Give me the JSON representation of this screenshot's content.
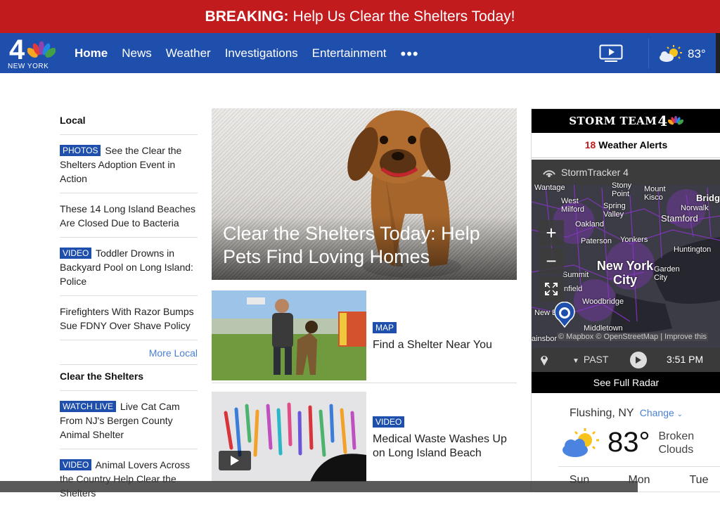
{
  "breaking": {
    "label": "BREAKING:",
    "text": "Help Us Clear the Shelters Today!"
  },
  "nav": {
    "logo_text": "NEW YORK",
    "logo_number": "4",
    "items": [
      "Home",
      "News",
      "Weather",
      "Investigations",
      "Entertainment"
    ],
    "more": "•••",
    "temp": "83°"
  },
  "local": {
    "title": "Local",
    "items": [
      {
        "tag": "PHOTOS",
        "text": "See the Clear the Shelters Adoption Event in Action"
      },
      {
        "tag": "",
        "text": "These 14 Long Island Beaches Are Closed Due to Bacteria"
      },
      {
        "tag": "VIDEO",
        "text": "Toddler Drowns in Backyard Pool on Long Island: Police"
      },
      {
        "tag": "",
        "text": "Firefighters With Razor Bumps Sue FDNY Over Shave Policy"
      }
    ],
    "more": "More Local"
  },
  "shelters": {
    "title": "Clear the Shelters",
    "items": [
      {
        "tag": "WATCH LIVE",
        "text": "Live Cat Cam From NJ's Bergen County Animal Shelter"
      },
      {
        "tag": "VIDEO",
        "text": "Animal Lovers Across the Country Help Clear the Shelters"
      }
    ]
  },
  "hero": {
    "title": "Clear the Shelters Today: Help Pets Find Loving Homes"
  },
  "stories": [
    {
      "tag": "MAP",
      "text": "Find a Shelter Near You"
    },
    {
      "tag": "VIDEO",
      "text": "Medical Waste Washes Up on Long Island Beach"
    }
  ],
  "weather": {
    "brand": "STORM TEAM",
    "brand_num": "4",
    "alerts_count": "18",
    "alerts_label": "Weather Alerts",
    "tracker": "StormTracker 4",
    "map_labels": {
      "wantage": "Wantage",
      "mount_kisco": "Mount Kisco",
      "stony_point": "Stony Point",
      "bridgeport": "Bridg",
      "west_milford": "West Milford",
      "spring_valley": "Spring Valley",
      "norwalk": "Norwalk",
      "stamford": "Stamford",
      "oakland": "Oakland",
      "paterson": "Paterson",
      "yonkers": "Yonkers",
      "huntington": "Huntington",
      "nyc": "New York City",
      "garden_city": "Garden City",
      "summit": "Summit",
      "plainfield": "nfield",
      "woodbridge": "Woodbridge",
      "new_brunswick": "New B   wick",
      "middletown": "Middletown",
      "plainsboro": "ainsbor"
    },
    "attribution": "© Mapbox © OpenStreetMap | Improve this",
    "past": "PAST",
    "time": "3:51 PM",
    "full_radar": "See Full Radar",
    "location": "Flushing, NY",
    "change": "Change",
    "temp": "83°",
    "condition": "Broken Clouds",
    "days": [
      "Sun",
      "Mon",
      "Tue"
    ]
  },
  "colors": {
    "brand_blue": "#1e4fad",
    "breaking_red": "#c11b1e",
    "radar_purple": "#8a35c9"
  }
}
